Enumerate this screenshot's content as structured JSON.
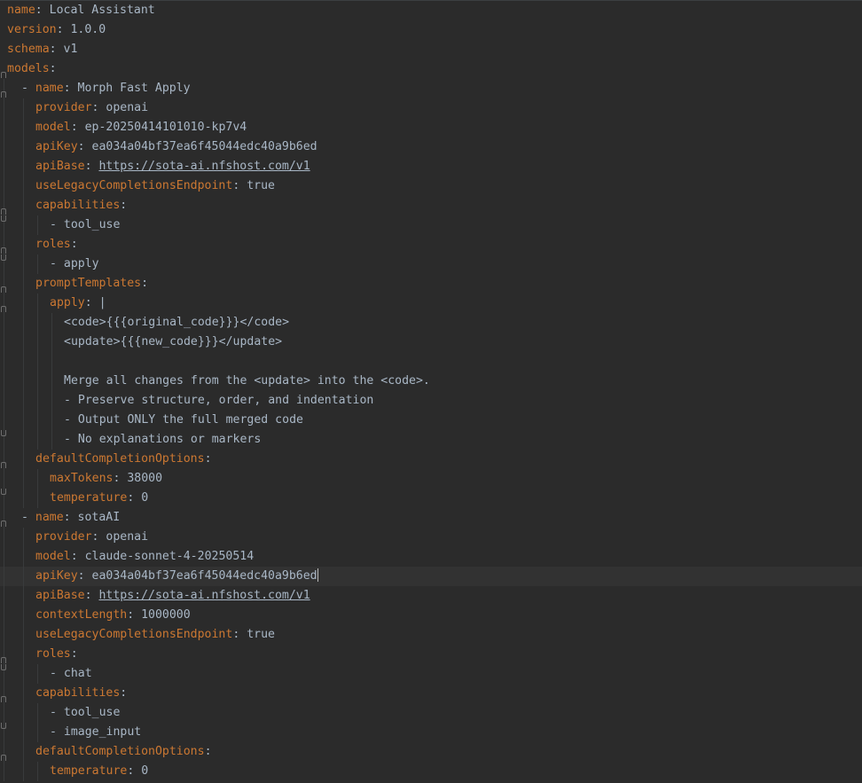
{
  "lines": [
    {
      "indent": 0,
      "key": "name",
      "value": "Local Assistant"
    },
    {
      "indent": 0,
      "key": "version",
      "value": "1.0.0"
    },
    {
      "indent": 0,
      "key": "schema",
      "value": "v1"
    },
    {
      "indent": 0,
      "key": "models",
      "value": ""
    },
    {
      "indent": 1,
      "dash": true,
      "key": "name",
      "value": "Morph Fast Apply"
    },
    {
      "indent": 2,
      "key": "provider",
      "value": "openai"
    },
    {
      "indent": 2,
      "key": "model",
      "value": "ep-20250414101010-kp7v4"
    },
    {
      "indent": 2,
      "key": "apiKey",
      "value": "ea034a04bf37ea6f45044edc40a9b6ed"
    },
    {
      "indent": 2,
      "key": "apiBase",
      "value": "https://sota-ai.nfshost.com/v1",
      "url": true
    },
    {
      "indent": 2,
      "key": "useLegacyCompletionsEndpoint",
      "value": "true"
    },
    {
      "indent": 2,
      "key": "capabilities",
      "value": ""
    },
    {
      "indent": 3,
      "dash": true,
      "value": "tool_use"
    },
    {
      "indent": 2,
      "key": "roles",
      "value": ""
    },
    {
      "indent": 3,
      "dash": true,
      "value": "apply"
    },
    {
      "indent": 2,
      "key": "promptTemplates",
      "value": ""
    },
    {
      "indent": 3,
      "key": "apply",
      "value": "|"
    },
    {
      "indent": 4,
      "value": "<code>{{{original_code}}}</code>"
    },
    {
      "indent": 4,
      "value": "<update>{{{new_code}}}</update>"
    },
    {
      "indent": 4,
      "value": ""
    },
    {
      "indent": 4,
      "value": "Merge all changes from the <update> into the <code>."
    },
    {
      "indent": 4,
      "value": "- Preserve structure, order, and indentation"
    },
    {
      "indent": 4,
      "value": "- Output ONLY the full merged code"
    },
    {
      "indent": 4,
      "value": "- No explanations or markers"
    },
    {
      "indent": 2,
      "key": "defaultCompletionOptions",
      "value": ""
    },
    {
      "indent": 3,
      "key": "maxTokens",
      "value": "38000"
    },
    {
      "indent": 3,
      "key": "temperature",
      "value": "0"
    },
    {
      "indent": 1,
      "dash": true,
      "key": "name",
      "value": "sotaAI"
    },
    {
      "indent": 2,
      "key": "provider",
      "value": "openai"
    },
    {
      "indent": 2,
      "key": "model",
      "value": "claude-sonnet-4-20250514"
    },
    {
      "indent": 2,
      "key": "apiKey",
      "value": "ea034a04bf37ea6f45044edc40a9b6ed",
      "current": true
    },
    {
      "indent": 2,
      "key": "apiBase",
      "value": "https://sota-ai.nfshost.com/v1",
      "url": true
    },
    {
      "indent": 2,
      "key": "contextLength",
      "value": "1000000"
    },
    {
      "indent": 2,
      "key": "useLegacyCompletionsEndpoint",
      "value": "true"
    },
    {
      "indent": 2,
      "key": "roles",
      "value": ""
    },
    {
      "indent": 3,
      "dash": true,
      "value": "chat"
    },
    {
      "indent": 2,
      "key": "capabilities",
      "value": ""
    },
    {
      "indent": 3,
      "dash": true,
      "value": "tool_use"
    },
    {
      "indent": 3,
      "dash": true,
      "value": "image_input"
    },
    {
      "indent": 2,
      "key": "defaultCompletionOptions",
      "value": ""
    },
    {
      "indent": 3,
      "key": "temperature",
      "value": "0"
    }
  ],
  "colors": {
    "background": "#2b2b2b",
    "key": "#cc7832",
    "value": "#a9b7c6",
    "current_line": "#323232"
  }
}
